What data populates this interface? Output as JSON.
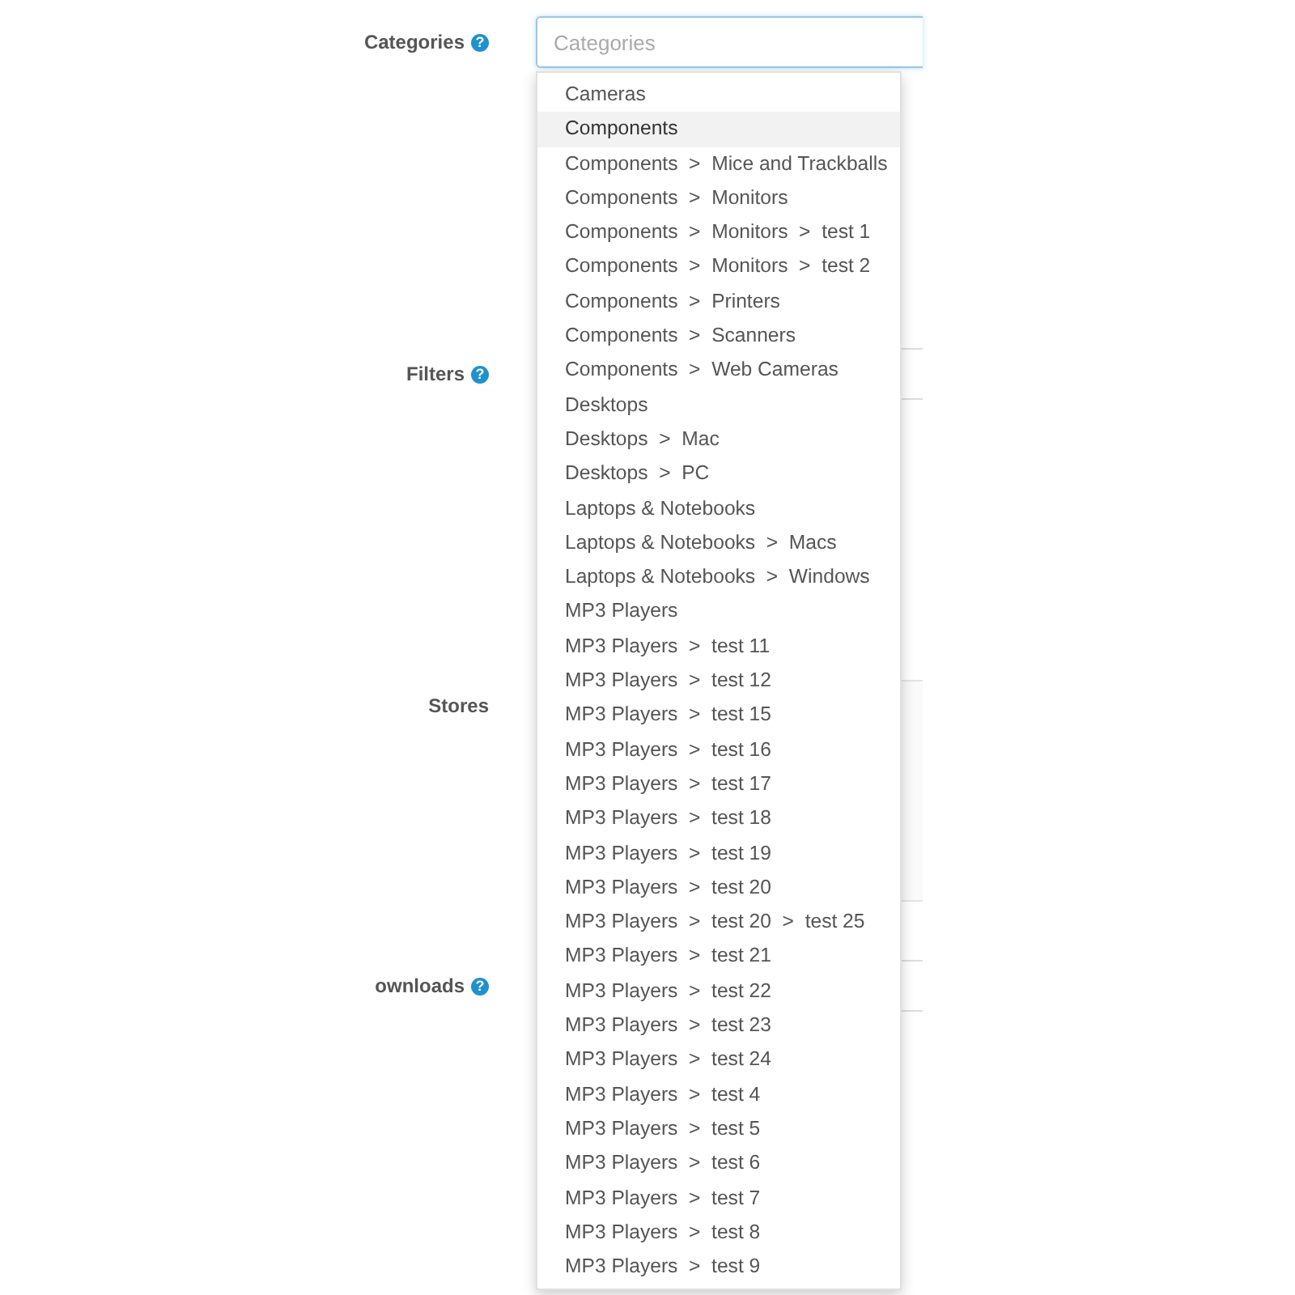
{
  "fields": [
    {
      "label": "Categories",
      "help": "?",
      "placeholder": "Categories",
      "focused": true
    },
    {
      "label": "Filters",
      "help": "?"
    },
    {
      "label": "Stores"
    },
    {
      "label": "ownloads",
      "help": "?"
    }
  ],
  "dropdown": {
    "items": [
      {
        "label": "Cameras",
        "selected": false
      },
      {
        "label": "Components",
        "selected": true
      },
      {
        "label": "Components  >  Mice and Trackballs",
        "selected": false
      },
      {
        "label": "Components  >  Monitors",
        "selected": false
      },
      {
        "label": "Components  >  Monitors  >  test 1",
        "selected": false
      },
      {
        "label": "Components  >  Monitors  >  test 2",
        "selected": false
      },
      {
        "label": "Components  >  Printers",
        "selected": false
      },
      {
        "label": "Components  >  Scanners",
        "selected": false
      },
      {
        "label": "Components  >  Web Cameras",
        "selected": false
      },
      {
        "label": "Desktops",
        "selected": false
      },
      {
        "label": "Desktops  >  Mac",
        "selected": false
      },
      {
        "label": "Desktops  >  PC",
        "selected": false
      },
      {
        "label": "Laptops & Notebooks",
        "selected": false
      },
      {
        "label": "Laptops & Notebooks  >  Macs",
        "selected": false
      },
      {
        "label": "Laptops & Notebooks  >  Windows",
        "selected": false
      },
      {
        "label": "MP3 Players",
        "selected": false
      },
      {
        "label": "MP3 Players  >  test 11",
        "selected": false
      },
      {
        "label": "MP3 Players  >  test 12",
        "selected": false
      },
      {
        "label": "MP3 Players  >  test 15",
        "selected": false
      },
      {
        "label": "MP3 Players  >  test 16",
        "selected": false
      },
      {
        "label": "MP3 Players  >  test 17",
        "selected": false
      },
      {
        "label": "MP3 Players  >  test 18",
        "selected": false
      },
      {
        "label": "MP3 Players  >  test 19",
        "selected": false
      },
      {
        "label": "MP3 Players  >  test 20",
        "selected": false
      },
      {
        "label": "MP3 Players  >  test 20  >  test 25",
        "selected": false
      },
      {
        "label": "MP3 Players  >  test 21",
        "selected": false
      },
      {
        "label": "MP3 Players  >  test 22",
        "selected": false
      },
      {
        "label": "MP3 Players  >  test 23",
        "selected": false
      },
      {
        "label": "MP3 Players  >  test 24",
        "selected": false
      },
      {
        "label": "MP3 Players  >  test 4",
        "selected": false
      },
      {
        "label": "MP3 Players  >  test 5",
        "selected": false
      },
      {
        "label": "MP3 Players  >  test 6",
        "selected": false
      },
      {
        "label": "MP3 Players  >  test 7",
        "selected": false
      },
      {
        "label": "MP3 Players  >  test 8",
        "selected": false
      },
      {
        "label": "MP3 Players  >  test 9",
        "selected": false
      }
    ]
  }
}
